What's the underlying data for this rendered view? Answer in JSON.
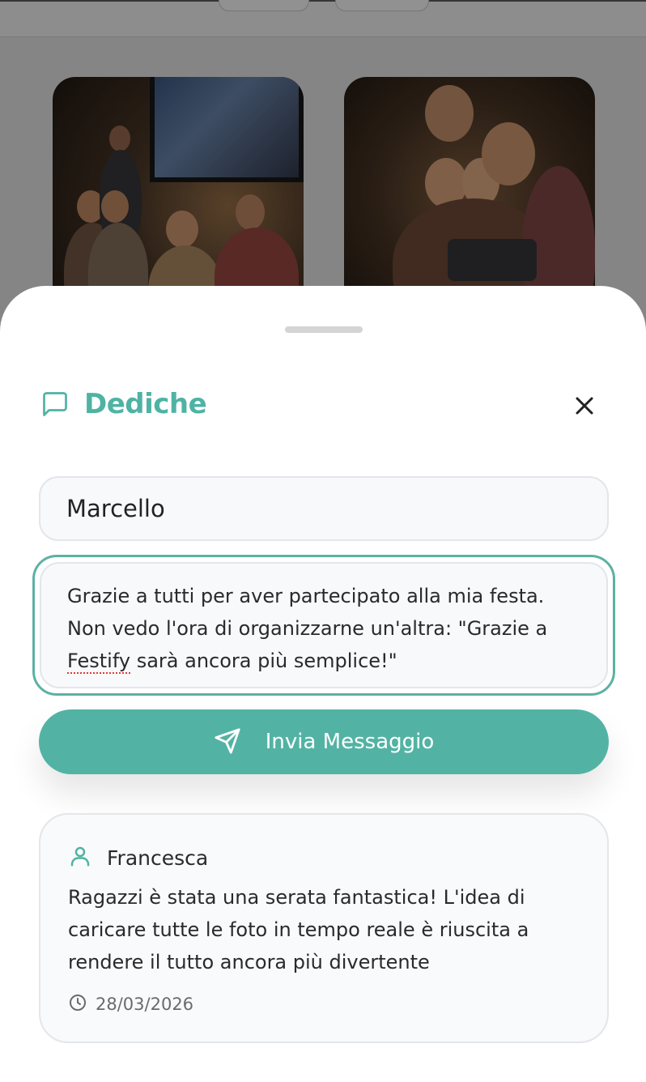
{
  "background": {
    "photos": [
      "party-screen-photo",
      "selfie-group-photo"
    ]
  },
  "sheet": {
    "title": "Dediche",
    "title_icon": "message-square-icon",
    "close_icon": "close-icon",
    "accent_color": "#52b3a4"
  },
  "form": {
    "name_value": "Marcello",
    "message_before": "Grazie a tutti per aver partecipato alla mia festa. Non vedo l'ora di organizzarne un'altra: \"Grazie a ",
    "message_misspelled": "Festify",
    "message_after": " sarà ancora più semplice!\"",
    "send_label": "Invia Messaggio",
    "send_icon": "send-icon"
  },
  "messages": [
    {
      "author": "Francesca",
      "text": "Ragazzi è stata una serata fantastica! L'idea di caricare tutte le foto in tempo reale è riuscita a rendere il tutto ancora più divertente",
      "date": "28/03/2026"
    }
  ]
}
